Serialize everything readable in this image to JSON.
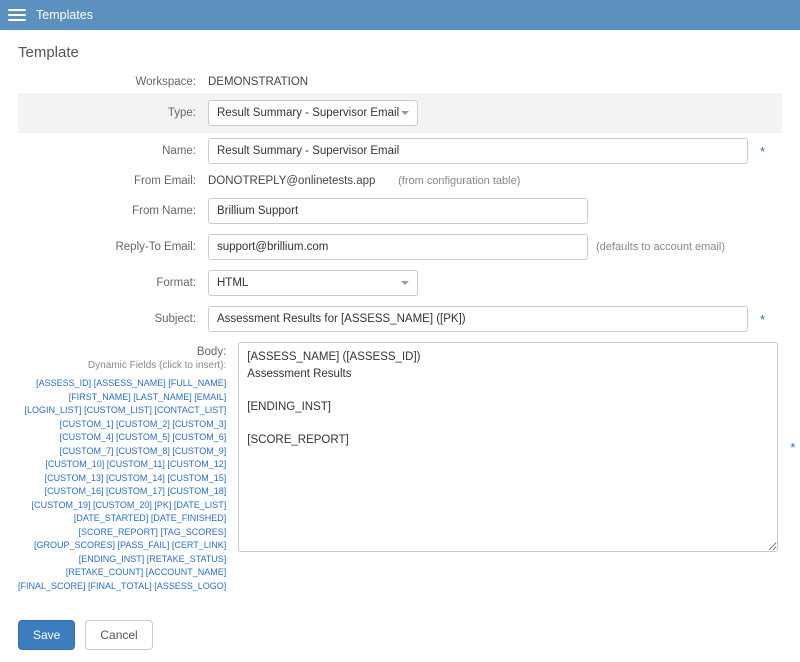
{
  "topbar": {
    "title": "Templates"
  },
  "page": {
    "title": "Template"
  },
  "form": {
    "workspace": {
      "label": "Workspace:",
      "value": "DEMONSTRATION"
    },
    "type": {
      "label": "Type:",
      "value": "Result Summary - Supervisor Email"
    },
    "name": {
      "label": "Name:",
      "value": "Result Summary - Supervisor Email"
    },
    "from_email": {
      "label": "From Email:",
      "value": "DONOTREPLY@onlinetests.app",
      "hint": "(from configuration table)"
    },
    "from_name": {
      "label": "From Name:",
      "value": "Brillium Support"
    },
    "reply_to": {
      "label": "Reply-To Email:",
      "value": "support@brillium.com",
      "hint": "(defaults to account email)"
    },
    "format": {
      "label": "Format:",
      "value": "HTML"
    },
    "subject": {
      "label": "Subject:",
      "value": "Assessment Results for [ASSESS_NAME] ([PK])"
    },
    "body": {
      "label": "Body:",
      "sublabel": "Dynamic Fields (click to insert):",
      "value": "[ASSESS_NAME] ([ASSESS_ID])\nAssessment Results\n\n[ENDING_INST]\n\n[SCORE_REPORT]"
    }
  },
  "dynamic_fields": [
    [
      "[ASSESS_ID]",
      "[ASSESS_NAME]",
      "[FULL_NAME]"
    ],
    [
      "[FIRST_NAME]",
      "[LAST_NAME]",
      "[EMAIL]"
    ],
    [
      "[LOGIN_LIST]",
      "[CUSTOM_LIST]",
      "[CONTACT_LIST]"
    ],
    [
      "[CUSTOM_1]",
      "[CUSTOM_2]",
      "[CUSTOM_3]"
    ],
    [
      "[CUSTOM_4]",
      "[CUSTOM_5]",
      "[CUSTOM_6]"
    ],
    [
      "[CUSTOM_7]",
      "[CUSTOM_8]",
      "[CUSTOM_9]"
    ],
    [
      "[CUSTOM_10]",
      "[CUSTOM_11]",
      "[CUSTOM_12]"
    ],
    [
      "[CUSTOM_13]",
      "[CUSTOM_14]",
      "[CUSTOM_15]"
    ],
    [
      "[CUSTOM_16]",
      "[CUSTOM_17]",
      "[CUSTOM_18]"
    ],
    [
      "[CUSTOM_19]",
      "[CUSTOM_20]",
      "[PK]",
      "[DATE_LIST]"
    ],
    [
      "[DATE_STARTED]",
      "[DATE_FINISHED]"
    ],
    [
      "[SCORE_REPORT]",
      "[TAG_SCORES]"
    ],
    [
      "[GROUP_SCORES]",
      "[PASS_FAIL]",
      "[CERT_LINK]"
    ],
    [
      "[ENDING_INST]",
      "[RETAKE_STATUS]"
    ],
    [
      "[RETAKE_COUNT]",
      "[ACCOUNT_NAME]"
    ],
    [
      "[FINAL_SCORE]",
      "[FINAL_TOTAL]",
      "[ASSESS_LOGO]"
    ]
  ],
  "buttons": {
    "save": "Save",
    "cancel": "Cancel"
  }
}
